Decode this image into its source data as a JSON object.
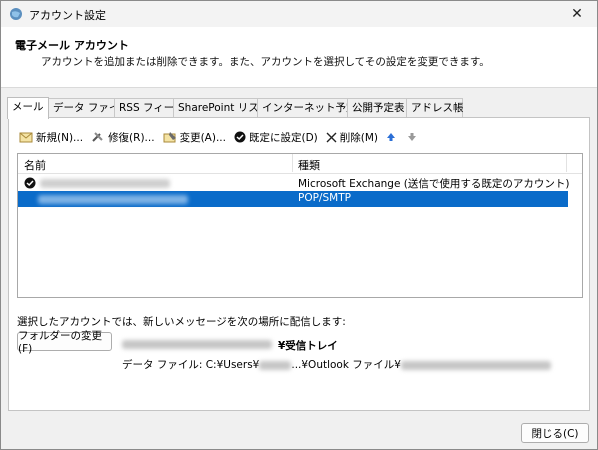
{
  "window": {
    "title": "アカウント設定",
    "close_glyph": "✕"
  },
  "header": {
    "title": "電子メール アカウント",
    "subtitle": "アカウントを追加または削除できます。また、アカウントを選択してその設定を変更できます。"
  },
  "tabs": [
    {
      "label": "メール",
      "active": true
    },
    {
      "label": "データ ファイル"
    },
    {
      "label": "RSS フィード"
    },
    {
      "label": "SharePoint リスト"
    },
    {
      "label": "インターネット予定表"
    },
    {
      "label": "公開予定表"
    },
    {
      "label": "アドレス帳"
    }
  ],
  "toolbar": {
    "new": "新規(N)...",
    "repair": "修復(R)...",
    "change": "変更(A)...",
    "set_default": "既定に設定(D)",
    "delete": "削除(M)"
  },
  "list": {
    "headers": {
      "name": "名前",
      "type": "種類"
    },
    "rows": [
      {
        "type": "Microsoft Exchange (送信で使用する既定のアカウント)",
        "default": true,
        "selected": false
      },
      {
        "type": "POP/SMTP",
        "default": false,
        "selected": true
      }
    ]
  },
  "delivery": {
    "info": "選択したアカウントでは、新しいメッセージを次の場所に配信します:",
    "change_folder_button": "フォルダーの変更(F)",
    "folder_suffix": "¥受信トレイ",
    "data_file_prefix": "データ ファイル: C:¥Users¥",
    "data_file_middle": "...¥Outlook ファイル¥"
  },
  "footer": {
    "close_button": "閉じる(C)"
  },
  "colors": {
    "selection": "#0a6bc9",
    "arrow_up": "#2b6fd6"
  }
}
